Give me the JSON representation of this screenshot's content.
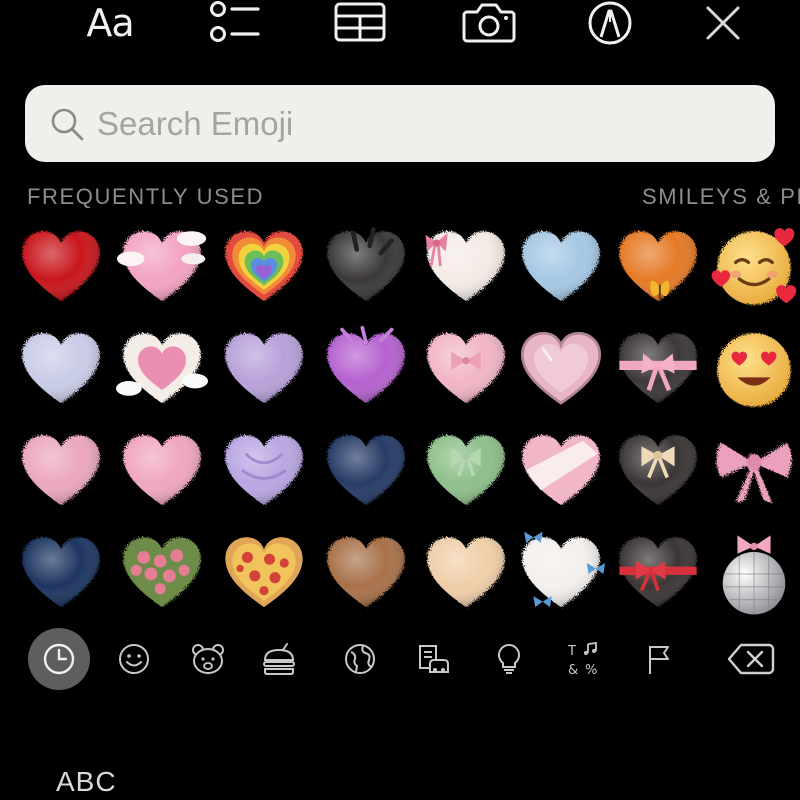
{
  "toolbar": {
    "text_style_label": "Aa",
    "items": [
      "text-style-icon",
      "checklist-icon",
      "table-icon",
      "camera-icon",
      "markup-pen-icon",
      "close-icon"
    ]
  },
  "search": {
    "placeholder": "Search Emoji",
    "value": ""
  },
  "sections": {
    "frequently_used": "FREQUENTLY USED",
    "smileys": "SMILEYS & PE"
  },
  "emoji_rows": [
    [
      "fuzzy-red-heart",
      "pink-heart-with-clouds",
      "rainbow-knit-heart",
      "black-fuzzy-heart",
      "white-heart-with-pink-bow",
      "light-blue-fuzzy-heart",
      "orange-heart-with-butterfly",
      "smiling-face-with-hearts"
    ],
    [
      "lavender-fuzzy-heart",
      "pink-heart-with-clouds-frame",
      "lilac-fuzzy-heart",
      "purple-feather-heart",
      "pink-heart-with-bow",
      "pink-crystal-heart",
      "black-heart-with-pink-ribbon",
      "heart-eyes-face"
    ],
    [
      "pink-fuzzy-heart",
      "light-pink-fuzzy-heart",
      "purple-patterned-heart",
      "navy-fuzzy-heart",
      "green-heart-with-bow",
      "pink-white-wrapped-heart",
      "black-heart-with-beige-bow",
      "pink-fuzzy-bow"
    ],
    [
      "navy-velvet-heart",
      "flower-bouquet-heart",
      "pizza-heart",
      "brown-fuzzy-heart",
      "beige-fuzzy-heart",
      "white-heart-with-blue-bows",
      "black-heart-with-red-bow",
      "disco-ball-with-bow"
    ]
  ],
  "colors": {
    "background": "#000000",
    "search_bg": "#efefec",
    "section_text": "#8d8d8d",
    "active_category_bg": "#5e5e5e"
  },
  "categories": [
    "recent-clock-icon",
    "smiley-icon",
    "animal-bear-icon",
    "food-icon",
    "globe-icon",
    "travel-places-icon",
    "lightbulb-objects-icon",
    "symbols-icon",
    "flag-icon",
    "delete-backspace-icon"
  ],
  "active_category": "recent-clock-icon",
  "keyboard_switch_label": "ABC"
}
